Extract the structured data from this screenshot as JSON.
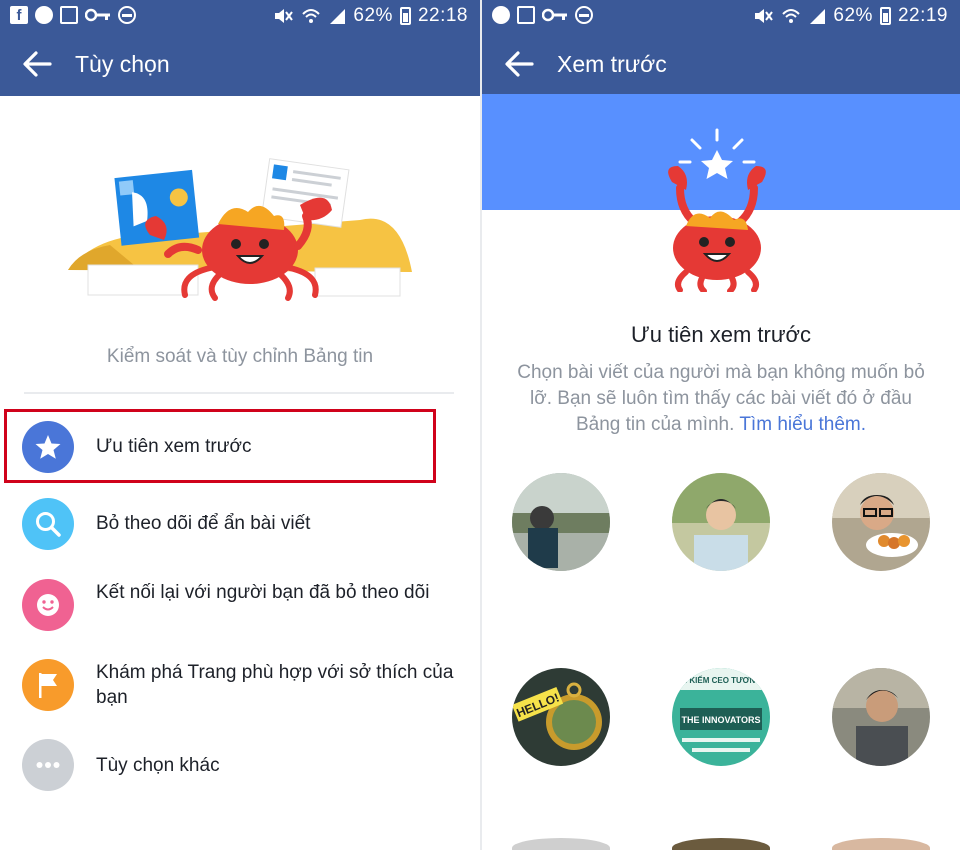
{
  "left": {
    "status": {
      "battery": "62%",
      "time": "22:18"
    },
    "app_bar": {
      "title": "Tùy chọn"
    },
    "subtitle": "Kiểm soát và tùy chỉnh Bảng tin",
    "menu": [
      {
        "label": "Ưu tiên xem trước",
        "icon": "star-icon",
        "color": "#4a76d8"
      },
      {
        "label": "Bỏ theo dõi để ẩn bài viết",
        "icon": "search-icon",
        "color": "#4fc3f7"
      },
      {
        "label": "Kết nối lại với người bạn đã bỏ theo dõi",
        "icon": "smile-icon",
        "color": "#f06292"
      },
      {
        "label": "Khám phá Trang phù hợp với sở thích của bạn",
        "icon": "flag-icon",
        "color": "#f89b2b"
      },
      {
        "label": "Tùy chọn khác",
        "icon": "more-icon",
        "color": "#ccd0d5"
      }
    ]
  },
  "right": {
    "status": {
      "battery": "62%",
      "time": "22:19"
    },
    "app_bar": {
      "title": "Xem trước"
    },
    "title": "Ưu tiên xem trước",
    "description": "Chọn bài viết của người mà bạn không muốn bỏ lỡ. Bạn sẽ luôn tìm thấy các bài viết đó ở đầu Bảng tin của mình.",
    "link": "Tìm hiểu thêm.",
    "avatar_texts": {
      "hello": "HELLO!",
      "innovators": "THE INNOVATORS",
      "search": "TÌM KIẾM CEO TƯƠNG L"
    }
  },
  "colors": {
    "facebook_blue": "#3b5998",
    "hero_blue": "#5890ff",
    "highlight_red": "#d0021b",
    "crab_red": "#e53935"
  }
}
